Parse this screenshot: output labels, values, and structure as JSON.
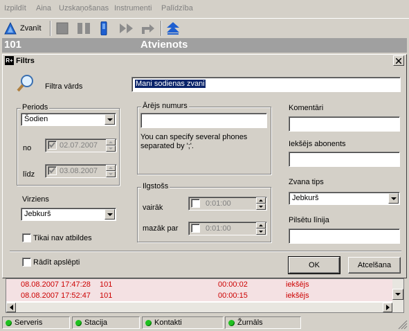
{
  "menu": [
    "Izpildīt",
    "Aina",
    "Uzskaņošanas",
    "Instrumenti",
    "Palīdzība"
  ],
  "toolbar": {
    "call_label": "Zvanīt"
  },
  "callbar": {
    "number": "101",
    "status": "Atvienots"
  },
  "dialog": {
    "title": "Filtrs",
    "title_icon": "R+",
    "filter_name_label": "Filtra vārds",
    "filter_name_value": "Mani sodienas zvani",
    "period": {
      "legend": "Periods",
      "selected": "Šodien",
      "from_label": "no",
      "from_value": "02.07.2007",
      "to_label": "līdz",
      "to_value": "03.08.2007"
    },
    "external": {
      "legend": "Ārējs numurs",
      "value": "",
      "hint": "You can specify several phones separated by ';'."
    },
    "duration": {
      "legend": "Ilgstošs",
      "more_label": "vairāk",
      "more_value": "0:01:00",
      "less_label": "mazāk par",
      "less_value": "0:01:00"
    },
    "direction": {
      "label": "Virziens",
      "selected": "Jebkurš"
    },
    "unanswered_label": "Tikai nav atbildes",
    "show_hidden_label": "Rādīt apslēpti",
    "comments_label": "Komentāri",
    "internal_label": "Iekšējs abonents",
    "call_type": {
      "label": "Zvana tips",
      "selected": "Jebkurš"
    },
    "city_line_label": "Pilsētu līnija",
    "ok_label": "OK",
    "cancel_label": "Atcelšana"
  },
  "calls": [
    {
      "datetime": "08.08.2007 17:47:28",
      "number": "101",
      "duration": "00:00:02",
      "type": "iekšējs"
    },
    {
      "datetime": "08.08.2007 17:52:47",
      "number": "101",
      "duration": "00:00:15",
      "type": "iekšējs"
    }
  ],
  "status": [
    "Serveris",
    "Stacija",
    "Kontakti",
    "Žurnāls"
  ],
  "colors": {
    "led": "#20c020",
    "row_text": "#cc0000",
    "row_bg": "#f4e1e3"
  }
}
